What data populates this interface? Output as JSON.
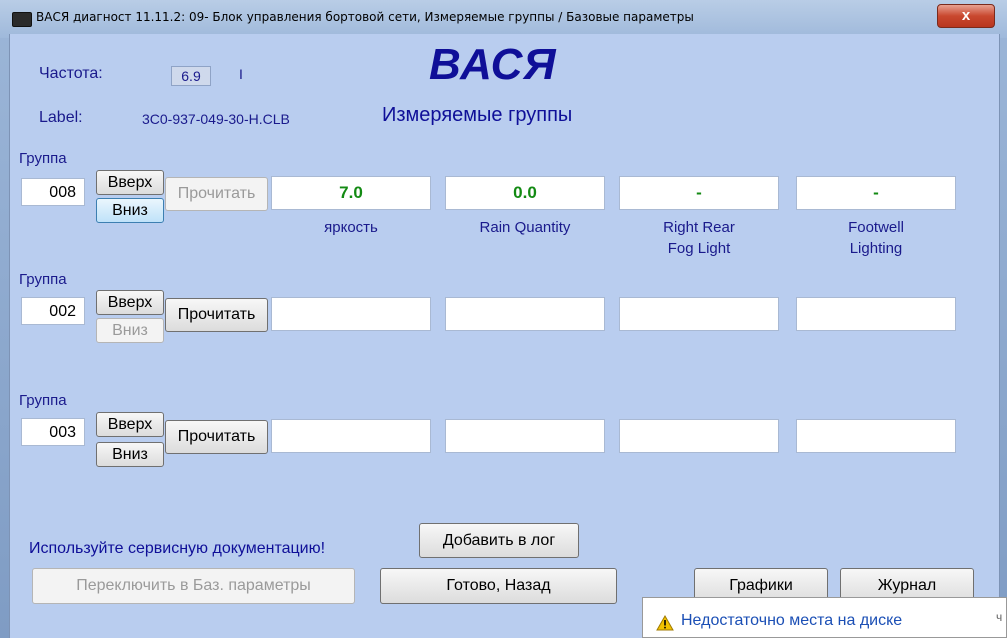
{
  "window": {
    "title": "ВАСЯ диагност 11.11.2: 09- Блок управления бортовой сети,  Измеряемые группы / Базовые параметры",
    "close_glyph": "x"
  },
  "header": {
    "frequency_label": "Частота:",
    "frequency_value": "6.9",
    "frequency_mark": "I",
    "brand": "ВАСЯ",
    "label_label": "Label:",
    "label_value": "3C0-937-049-30-H.CLB",
    "subtitle": "Измеряемые группы"
  },
  "groups": [
    {
      "label": "Группа",
      "number": "008",
      "up_label": "Вверх",
      "down_label": "Вниз",
      "read_label": "Прочитать",
      "values": [
        "7.0",
        "0.0",
        "-",
        "-"
      ],
      "captions": [
        "яркость",
        "Rain Quantity",
        "Right Rear\nFog Light",
        "Footwell\nLighting"
      ]
    },
    {
      "label": "Группа",
      "number": "002",
      "up_label": "Вверх",
      "down_label": "Вниз",
      "read_label": "Прочитать",
      "values": [
        "",
        "",
        "",
        ""
      ]
    },
    {
      "label": "Группа",
      "number": "003",
      "up_label": "Вверх",
      "down_label": "Вниз",
      "read_label": "Прочитать",
      "values": [
        "",
        "",
        "",
        ""
      ]
    }
  ],
  "footer": {
    "service_text": "Используйте сервисную документацию!",
    "add_log_label": "Добавить в лог",
    "switch_basic_label": "Переключить в Баз. параметры",
    "done_back_label": "Готово, Назад",
    "graphs_label": "Графики",
    "journal_label": "Журнал"
  },
  "notification": {
    "text": "Недостаточно места на диске",
    "icon": "warning-icon",
    "mark": "ч"
  },
  "colors": {
    "client_bg": "#b9cdef",
    "label_text": "#1a1a8c",
    "value_green": "#138a13",
    "close_red": "#c9482f"
  }
}
